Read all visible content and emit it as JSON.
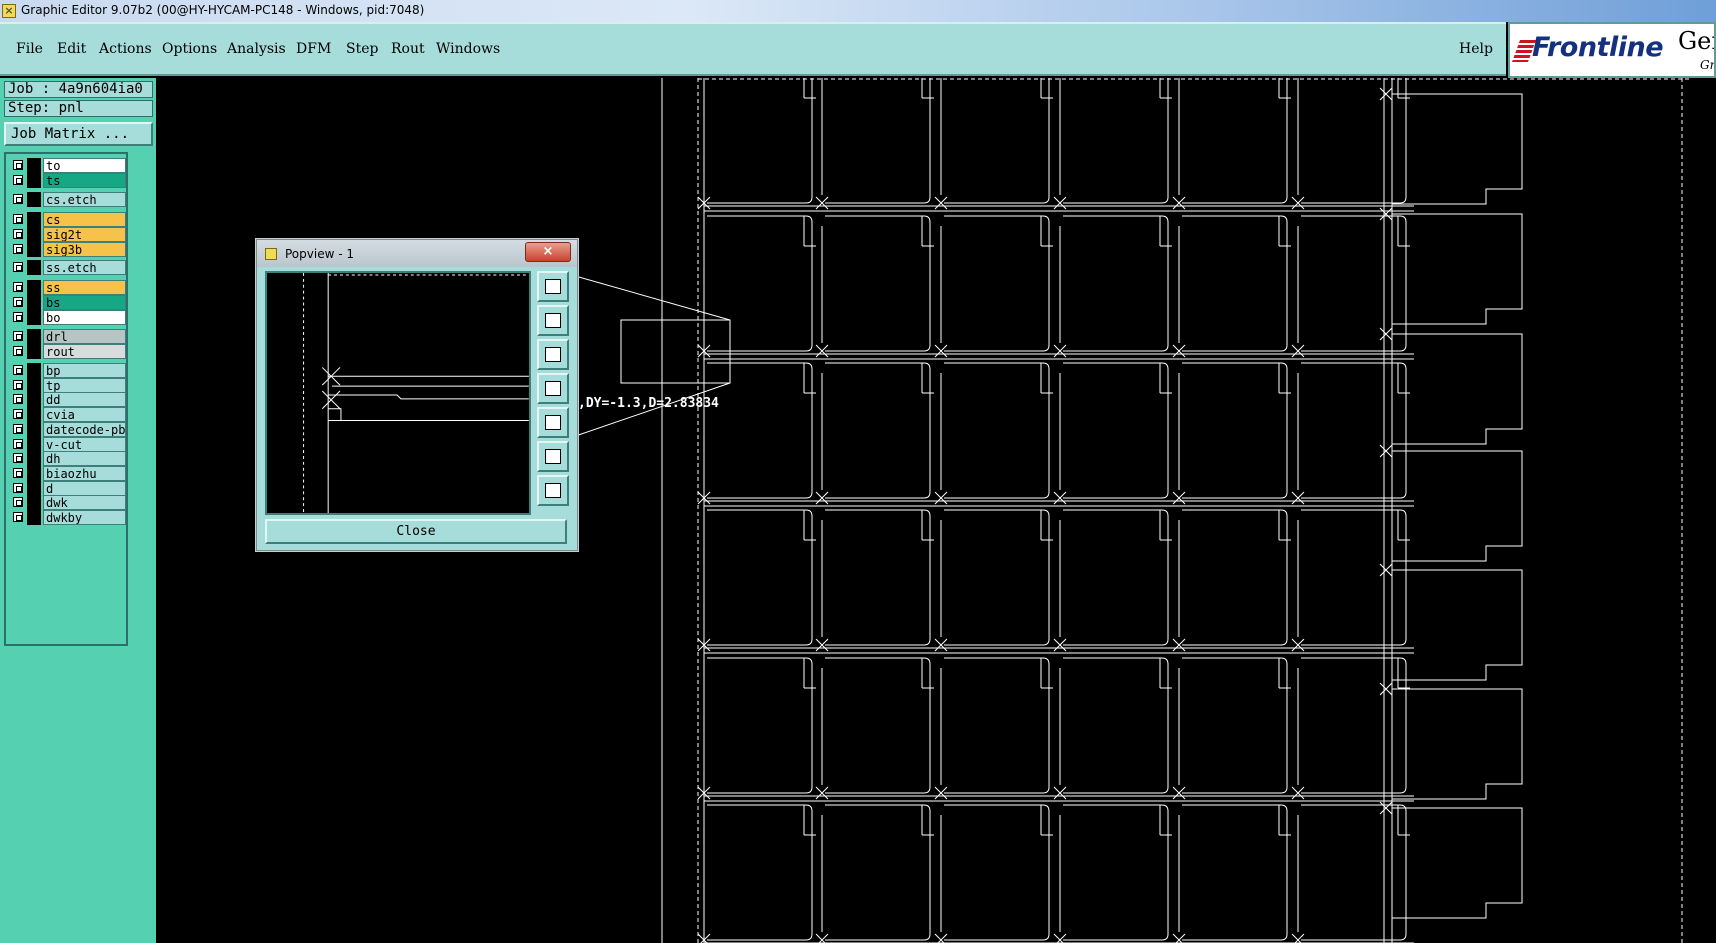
{
  "window": {
    "title": "Graphic Editor 9.07b2 (00@HY-HYCAM-PC148 - Windows, pid:7048)"
  },
  "menu": {
    "items": [
      {
        "label": "File",
        "name": "menu-file"
      },
      {
        "label": "Edit",
        "name": "menu-edit"
      },
      {
        "label": "Actions",
        "name": "menu-actions"
      },
      {
        "label": "Options",
        "name": "menu-options"
      },
      {
        "label": "Analysis",
        "name": "menu-analysis"
      },
      {
        "label": "DFM",
        "name": "menu-dfm"
      },
      {
        "label": "Step",
        "name": "menu-step"
      },
      {
        "label": "Rout",
        "name": "menu-rout"
      },
      {
        "label": "Windows",
        "name": "menu-windows"
      }
    ],
    "help": "Help"
  },
  "logo": {
    "brand": "Frontline",
    "gen": "Gen",
    "gr": "Gr"
  },
  "job": {
    "job_label": "Job : 4a9n604ia0",
    "step_label": "Step: pnl",
    "matrix_button": "Job Matrix ..."
  },
  "layers": [
    {
      "name": "to",
      "color": "#ffffff"
    },
    {
      "name": "ts",
      "color": "#16a884"
    },
    {
      "name": "cs.etch",
      "color": "#a6dcd9"
    },
    {
      "name": "cs",
      "color": "#f6c24a"
    },
    {
      "name": "sig2t",
      "color": "#f6c24a"
    },
    {
      "name": "sig3b",
      "color": "#f6c24a"
    },
    {
      "name": "ss.etch",
      "color": "#a6dcd9"
    },
    {
      "name": "ss",
      "color": "#f6c24a"
    },
    {
      "name": "bs",
      "color": "#16a884"
    },
    {
      "name": "bo",
      "color": "#ffffff"
    },
    {
      "name": "drl",
      "color": "#b7c4c4"
    },
    {
      "name": "rout",
      "color": "#d9dcdc"
    },
    {
      "name": "bp",
      "color": "#a6dcd9"
    },
    {
      "name": "tp",
      "color": "#a6dcd9"
    },
    {
      "name": "dd",
      "color": "#a6dcd9"
    },
    {
      "name": "cvia",
      "color": "#a6dcd9"
    },
    {
      "name": "datecode-pbc",
      "color": "#a6dcd9"
    },
    {
      "name": "v-cut",
      "color": "#a6dcd9"
    },
    {
      "name": "dh",
      "color": "#a6dcd9"
    },
    {
      "name": "biaozhu",
      "color": "#a6dcd9"
    },
    {
      "name": "d",
      "color": "#a6dcd9"
    },
    {
      "name": "dwk",
      "color": "#a6dcd9"
    },
    {
      "name": "dwkby",
      "color": "#a6dcd9"
    }
  ],
  "popview": {
    "title": "Popview - 1",
    "close_x": "×",
    "close_label": "Close",
    "tools": [
      {
        "name": "zoom-home-icon"
      },
      {
        "name": "pan-up-icon"
      },
      {
        "name": "pan-down-icon"
      },
      {
        "name": "pan-left-icon"
      },
      {
        "name": "pan-right-icon"
      },
      {
        "name": "zoom-in-icon"
      },
      {
        "name": "zoom-out-icon"
      }
    ]
  },
  "measure": {
    "text": ",DY=-1.3,D=2.83834"
  },
  "colors": {
    "panel": "#a6dcd9",
    "sidebar": "#55d0b0",
    "canvas": "#000000",
    "lines": "#ffffff"
  }
}
